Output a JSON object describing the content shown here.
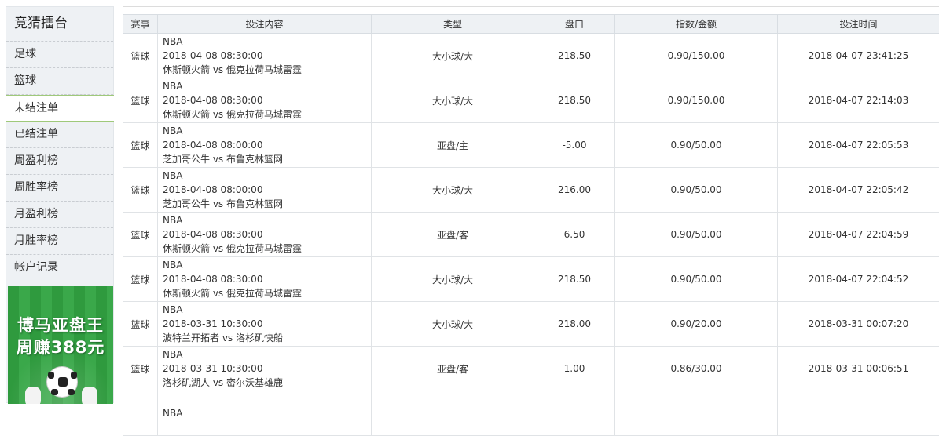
{
  "sidebar": {
    "title": "竞猜擂台",
    "items": [
      {
        "label": "足球"
      },
      {
        "label": "篮球"
      },
      {
        "label": "未结注单",
        "active": true
      },
      {
        "label": "已结注单"
      },
      {
        "label": "周盈利榜"
      },
      {
        "label": "周胜率榜"
      },
      {
        "label": "月盈利榜"
      },
      {
        "label": "月胜率榜"
      },
      {
        "label": "帐户记录"
      }
    ],
    "ad": {
      "line1": "博马亚盘王",
      "line2": "周赚388元"
    }
  },
  "table": {
    "headers": [
      "赛事",
      "投注内容",
      "类型",
      "盘口",
      "指数/金额",
      "投注时间"
    ],
    "rows": [
      {
        "sport": "篮球",
        "league": "NBA",
        "match_time": "2018-04-08 08:30:00",
        "teams": "休斯顿火箭 vs 俄克拉荷马城雷霆",
        "type": "大小球/大",
        "line": "218.50",
        "odds": "0.90/150.00",
        "bet_time": "2018-04-07 23:41:25"
      },
      {
        "sport": "篮球",
        "league": "NBA",
        "match_time": "2018-04-08 08:30:00",
        "teams": "休斯顿火箭 vs 俄克拉荷马城雷霆",
        "type": "大小球/大",
        "line": "218.50",
        "odds": "0.90/150.00",
        "bet_time": "2018-04-07 22:14:03"
      },
      {
        "sport": "篮球",
        "league": "NBA",
        "match_time": "2018-04-08 08:00:00",
        "teams": "芝加哥公牛 vs 布鲁克林篮网",
        "type": "亚盘/主",
        "line": "-5.00",
        "odds": "0.90/50.00",
        "bet_time": "2018-04-07 22:05:53"
      },
      {
        "sport": "篮球",
        "league": "NBA",
        "match_time": "2018-04-08 08:00:00",
        "teams": "芝加哥公牛 vs 布鲁克林篮网",
        "type": "大小球/大",
        "line": "216.00",
        "odds": "0.90/50.00",
        "bet_time": "2018-04-07 22:05:42"
      },
      {
        "sport": "篮球",
        "league": "NBA",
        "match_time": "2018-04-08 08:30:00",
        "teams": "休斯顿火箭 vs 俄克拉荷马城雷霆",
        "type": "亚盘/客",
        "line": "6.50",
        "odds": "0.90/50.00",
        "bet_time": "2018-04-07 22:04:59"
      },
      {
        "sport": "篮球",
        "league": "NBA",
        "match_time": "2018-04-08 08:30:00",
        "teams": "休斯顿火箭 vs 俄克拉荷马城雷霆",
        "type": "大小球/大",
        "line": "218.50",
        "odds": "0.90/50.00",
        "bet_time": "2018-04-07 22:04:52"
      },
      {
        "sport": "篮球",
        "league": "NBA",
        "match_time": "2018-03-31 10:30:00",
        "teams": "波特兰开拓者 vs 洛杉矶快船",
        "type": "大小球/大",
        "line": "218.00",
        "odds": "0.90/20.00",
        "bet_time": "2018-03-31 00:07:20"
      },
      {
        "sport": "篮球",
        "league": "NBA",
        "match_time": "2018-03-31 10:30:00",
        "teams": "洛杉矶湖人 vs 密尔沃基雄鹿",
        "type": "亚盘/客",
        "line": "1.00",
        "odds": "0.86/30.00",
        "bet_time": "2018-03-31 00:06:51"
      },
      {
        "sport": "",
        "league": "NBA",
        "match_time": "",
        "teams": "",
        "type": "",
        "line": "",
        "odds": "",
        "bet_time": ""
      }
    ]
  }
}
